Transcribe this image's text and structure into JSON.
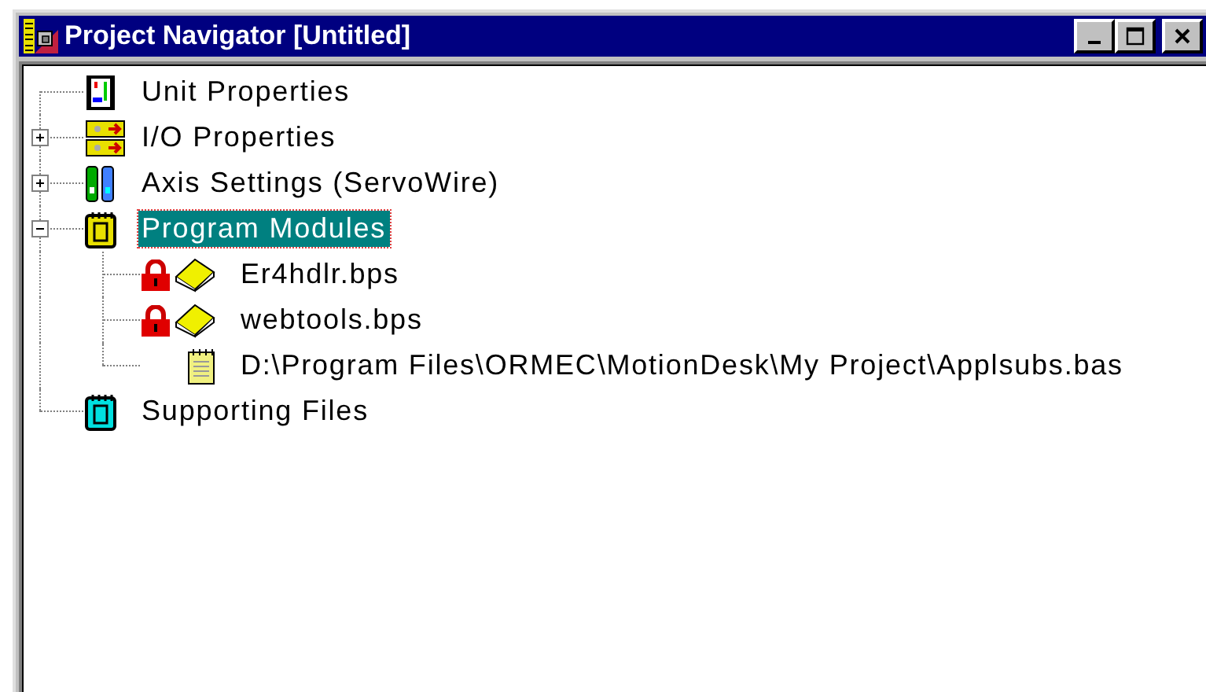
{
  "window": {
    "title": "Project Navigator [Untitled]"
  },
  "tree": [
    {
      "label": "Unit Properties",
      "kind": "unit",
      "selected": false
    },
    {
      "label": "I/O Properties",
      "kind": "io",
      "expanded": false,
      "selected": false
    },
    {
      "label": "Axis Settings (ServoWire)",
      "kind": "axis",
      "expanded": false,
      "selected": false
    },
    {
      "label": "Program Modules",
      "kind": "program",
      "expanded": true,
      "selected": true,
      "children": [
        {
          "label": "Er4hdlr.bps",
          "kind": "module",
          "locked": true,
          "selected": false
        },
        {
          "label": "webtools.bps",
          "kind": "module",
          "locked": true,
          "selected": false
        },
        {
          "label": "D:\\Program Files\\ORMEC\\MotionDesk\\My Project\\Applsubs.bas",
          "kind": "source",
          "selected": false
        }
      ]
    },
    {
      "label": "Supporting Files",
      "kind": "files",
      "selected": false
    }
  ]
}
